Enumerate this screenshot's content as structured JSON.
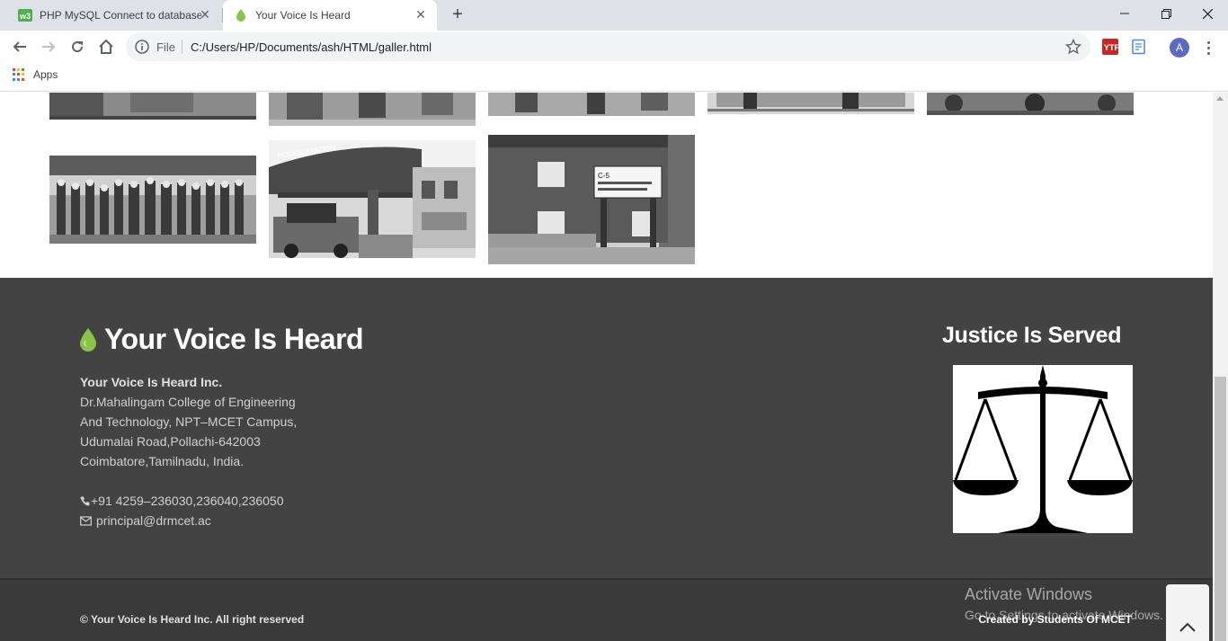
{
  "browser": {
    "tabs": [
      {
        "title": "PHP MySQL Connect to database",
        "active": false
      },
      {
        "title": "Your Voice Is Heard",
        "active": true
      }
    ],
    "address": {
      "scheme_label": "File",
      "url": "C:/Users/HP/Documents/ash/HTML/galler.html"
    },
    "bookmarks": {
      "apps_label": "Apps"
    },
    "profile_initial": "A"
  },
  "footer": {
    "brand": "Your Voice Is Heard",
    "address": {
      "org": "Your Voice Is Heard Inc.",
      "line1": "Dr.Mahalingam College of Engineering",
      "line2": "And Technology, NPT–MCET Campus,",
      "line3": "Udumalai Road,Pollachi-642003",
      "line4": "Coimbatore,Tamilnadu, India."
    },
    "phone": "+91 4259–236030,236040,236050",
    "email": "principal@drmcet.ac",
    "justice_title": "Justice Is Served",
    "copyright": "© Your Voice Is Heard Inc. All right reserved",
    "credit": "Created by Students Of MCET"
  },
  "watermark": {
    "title": "Activate Windows",
    "subtitle": "Go to Settings to activate Windows."
  },
  "colors": {
    "footer_bg": "#434343",
    "bottom_bg": "#3a3a3a",
    "accent_green": "#8bc34a"
  }
}
